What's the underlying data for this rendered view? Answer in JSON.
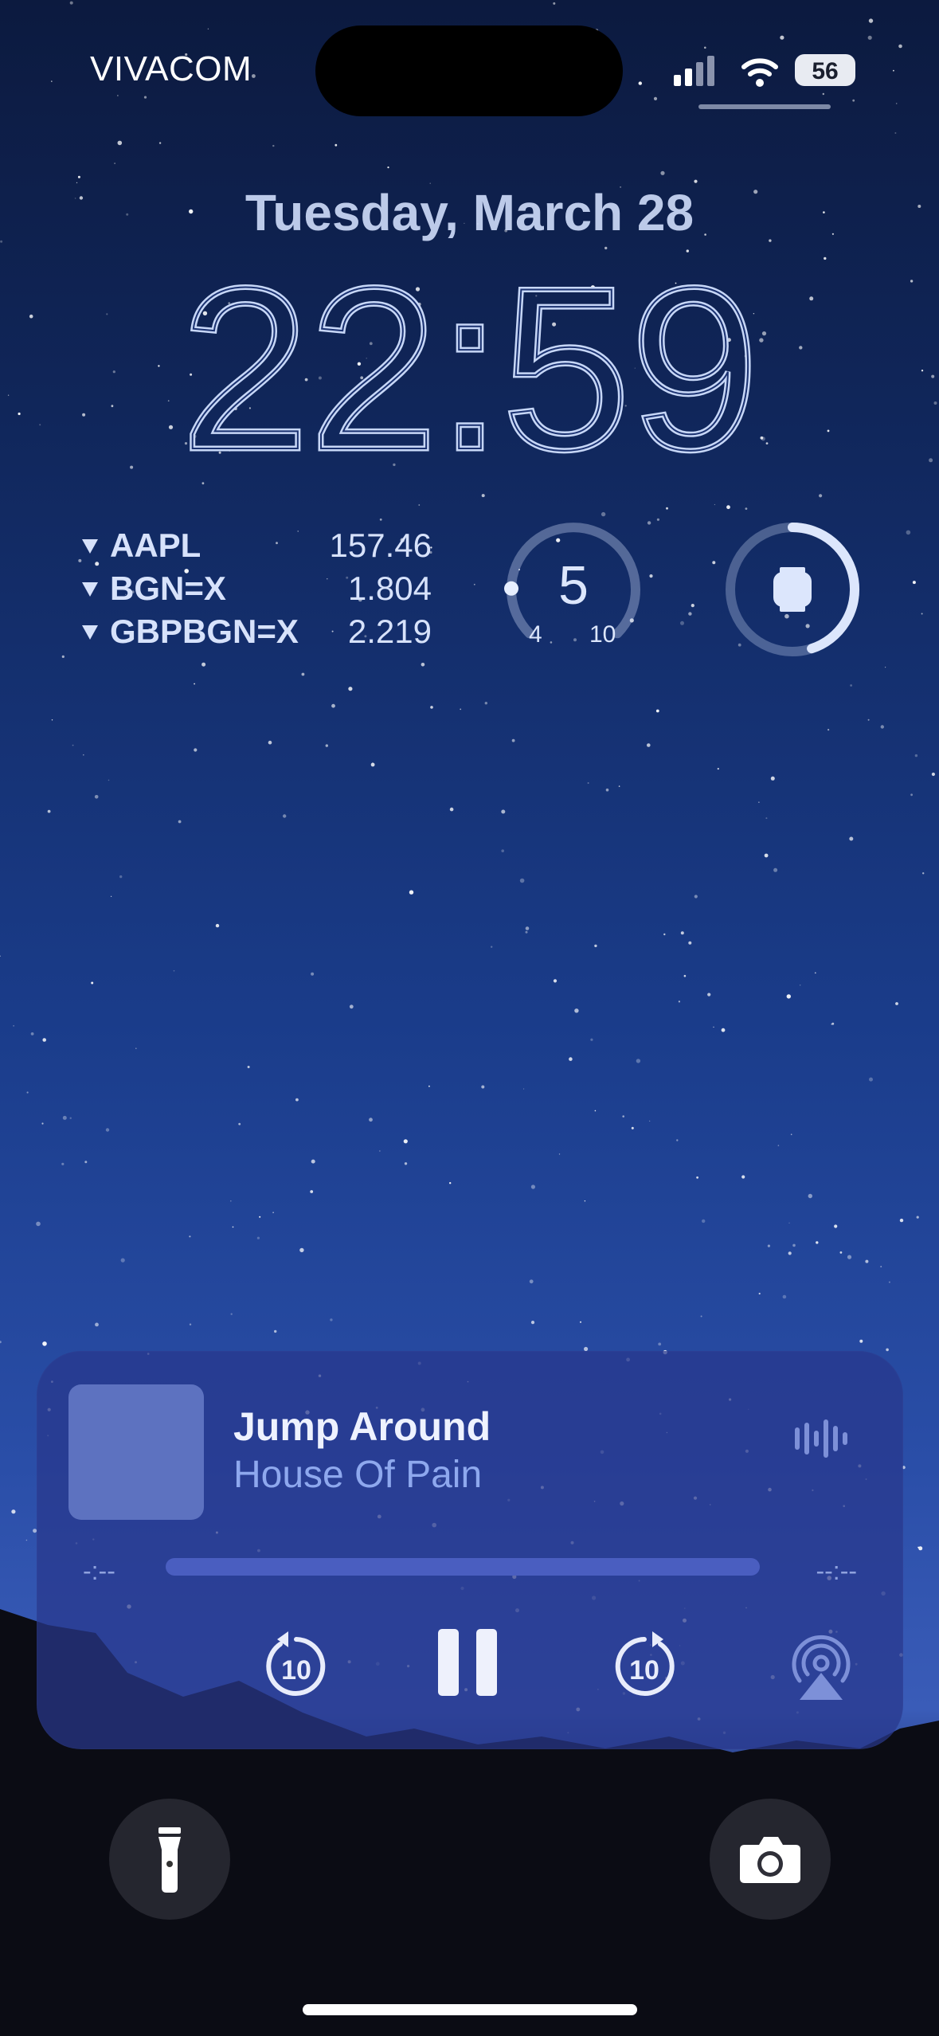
{
  "status_bar": {
    "carrier": "VIVACOM",
    "battery": "56"
  },
  "lock_screen": {
    "date": "Tuesday, March 28",
    "time": "22:59"
  },
  "widgets": {
    "stocks": [
      {
        "symbol": "AAPL",
        "value": "157.46",
        "trend": "down"
      },
      {
        "symbol": "BGN=X",
        "value": "1.804",
        "trend": "down"
      },
      {
        "symbol": "GBPBGN=X",
        "value": "2.219",
        "trend": "down"
      }
    ],
    "gauge": {
      "value": "5",
      "min": "4",
      "max": "10",
      "level_fraction": 0.17
    },
    "watch_battery": {
      "icon": "watch-icon",
      "level_fraction": 0.45
    }
  },
  "now_playing": {
    "title": "Jump Around",
    "artist": "House Of Pain",
    "elapsed": "-:--",
    "remaining": "--:--",
    "skip_back_label": "10",
    "skip_forward_label": "10",
    "progress_fraction": 0
  },
  "quick_actions": {
    "left_icon": "flashlight-icon",
    "right_icon": "camera-icon"
  },
  "colors": {
    "accent_light": "#c6d4f2",
    "player_bg": "#28388c",
    "progress_track": "#4a5ec0"
  }
}
